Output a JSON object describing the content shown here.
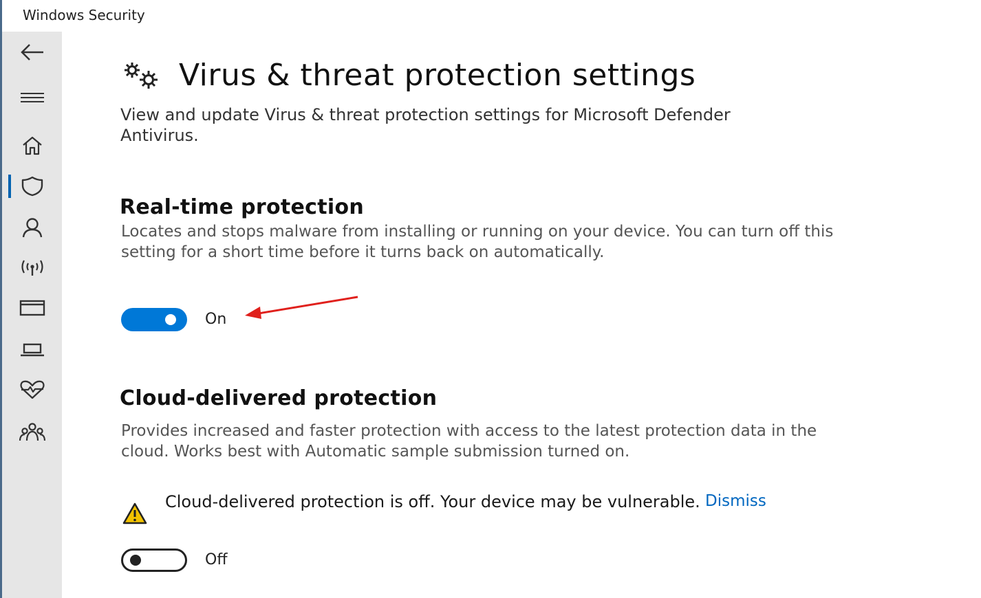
{
  "window": {
    "app_title": "Windows Security"
  },
  "sidebar": {
    "items": [
      {
        "name": "back",
        "icon": "back-arrow-icon"
      },
      {
        "name": "menu",
        "icon": "hamburger-menu-icon"
      },
      {
        "name": "home",
        "icon": "home-icon"
      },
      {
        "name": "virus-threat-protection",
        "icon": "shield-icon",
        "active": true
      },
      {
        "name": "account-protection",
        "icon": "person-icon"
      },
      {
        "name": "firewall-network",
        "icon": "wireless-signal-icon"
      },
      {
        "name": "app-browser-control",
        "icon": "browser-window-icon"
      },
      {
        "name": "device-security",
        "icon": "laptop-icon"
      },
      {
        "name": "device-performance-health",
        "icon": "heart-pulse-icon"
      },
      {
        "name": "family-options",
        "icon": "family-group-icon"
      }
    ],
    "accent_color": "#0063b1"
  },
  "header": {
    "icon": "gears-icon",
    "title": "Virus & threat protection settings",
    "description": "View and update Virus & threat protection settings for Microsoft Defender Antivirus."
  },
  "realtime": {
    "title": "Real-time protection",
    "description": "Locates and stops malware from installing or running on your device. You can turn off this setting for a short time before it turns back on automatically.",
    "toggle_state": "on",
    "toggle_label": "On"
  },
  "cloud": {
    "title": "Cloud-delivered protection",
    "description": "Provides increased and faster protection with access to the latest protection data in the cloud. Works best with Automatic sample submission turned on.",
    "warning_icon": "warning-triangle-icon",
    "warning_text": "Cloud-delivered protection is off. Your device may be vulnerable.",
    "dismiss_label": "Dismiss",
    "toggle_state": "off",
    "toggle_label": "Off"
  },
  "colors": {
    "toggle_on": "#0078d7",
    "link": "#0067c0",
    "annotation_arrow": "#e0201c",
    "warning_fill": "#f2c200"
  }
}
